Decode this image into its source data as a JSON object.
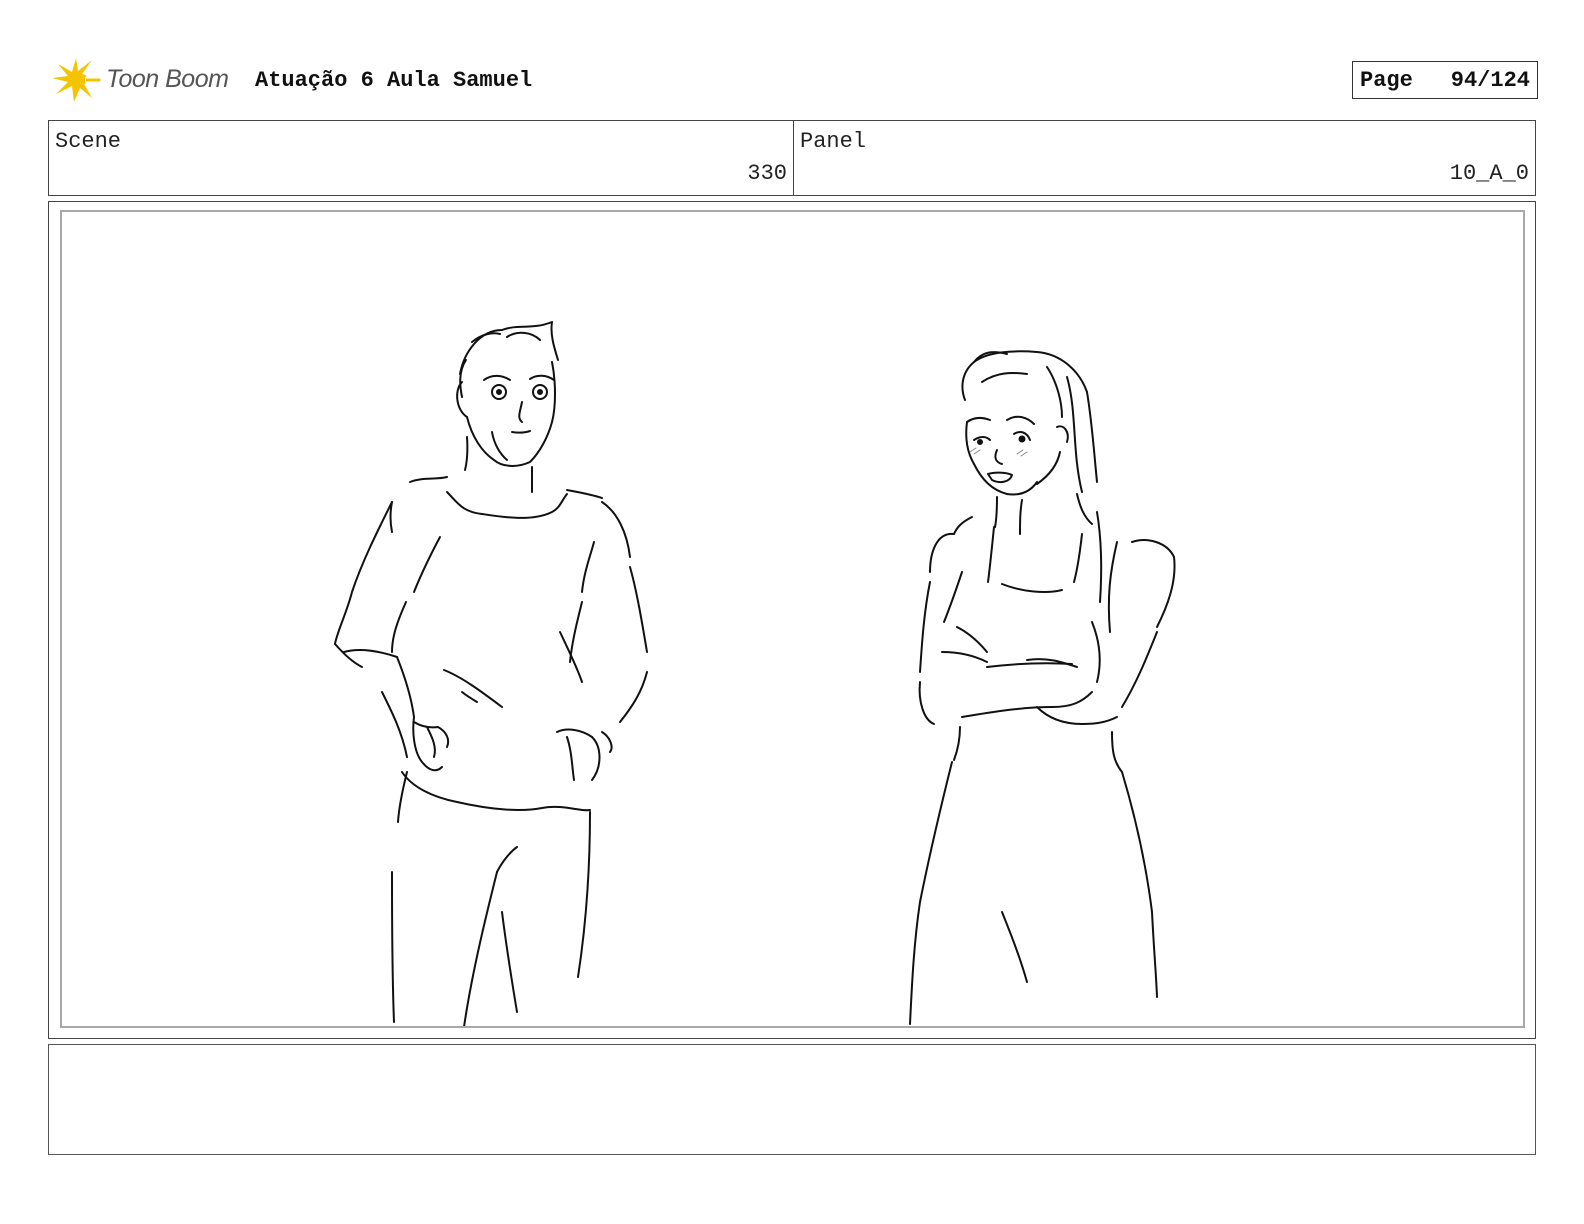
{
  "header": {
    "logo_text": "Toon Boom",
    "logo_icon": "toon-boom-burst-icon",
    "title": "Atuação 6 Aula Samuel",
    "page_label": "Page",
    "page_number": "94/124"
  },
  "info": {
    "scene_label": "Scene",
    "scene_value": "330",
    "panel_label": "Panel",
    "panel_value": "10_A_0"
  },
  "frame": {
    "content": "line-drawing",
    "figures": [
      "man-figure",
      "woman-figure"
    ]
  },
  "notes": {
    "text": ""
  },
  "colors": {
    "logo_accent": "#f5c400",
    "logo_text": "#555555",
    "frame_border": "#444444",
    "inner_border": "#a8a8a8"
  }
}
